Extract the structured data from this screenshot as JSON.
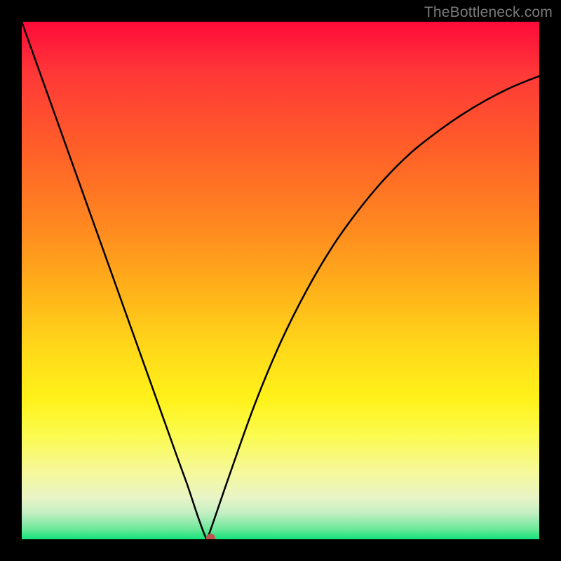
{
  "watermark": {
    "text": "TheBottleneck.com"
  },
  "chart_data": {
    "type": "line",
    "title": "",
    "xlabel": "",
    "ylabel": "",
    "xlim": [
      0,
      100
    ],
    "ylim": [
      0,
      100
    ],
    "x": [
      0,
      5,
      10,
      15,
      20,
      25,
      30,
      32,
      34,
      35.5,
      36,
      40,
      45,
      50,
      55,
      60,
      65,
      70,
      75,
      80,
      85,
      90,
      95,
      100
    ],
    "values": [
      100,
      86,
      72,
      58,
      44,
      30,
      16,
      10.5,
      4.5,
      0.5,
      0.5,
      12,
      26,
      38,
      48,
      56.5,
      63.5,
      69.5,
      74.5,
      78.5,
      82,
      85,
      87.5,
      89.5
    ],
    "marker": {
      "x": 36.5,
      "y": 0.2
    },
    "background": "vertical-gradient-red-to-green"
  }
}
